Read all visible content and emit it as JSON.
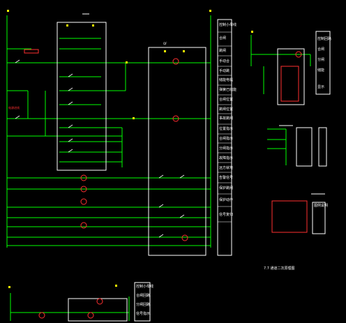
{
  "diagram": {
    "caption": "7.7 通道二次原理图",
    "main_breaker_label": "QF",
    "right_panel_labels": [
      "控制小母线",
      "合闸",
      "跳闸",
      "手动合",
      "手动跳",
      "储能电机",
      "弹簧已储能",
      "合闸位置",
      "跳闸位置",
      "事故跳闸",
      "位置指示",
      "合闸指示",
      "分闸指示",
      "故障指示",
      "远方就地",
      "告警信号",
      "保护跳闸",
      "保护动作",
      "信号复归"
    ],
    "mini_table_labels": [
      "控制回路",
      "合闸",
      "分闸",
      "储能",
      "显示"
    ],
    "bottom_table_labels": [
      "控制小母线",
      "合闸回路",
      "分闸回路",
      "信号指示"
    ],
    "legend_box_title": "图例说明",
    "red_annotation": "电源进线",
    "colors": {
      "background": "#000000",
      "wire": "#00ff00",
      "box": "#ffffff",
      "component": "#ff3030",
      "marker": "#ffff00"
    }
  }
}
